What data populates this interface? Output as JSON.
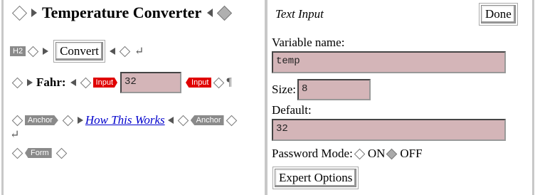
{
  "editor": {
    "heading": "Temperature Converter",
    "h2_tag": "H2",
    "convert_button": "Convert",
    "fahr_label": "Fahr:",
    "input_tag_open": "Input",
    "input_tag_close": "Input",
    "fahr_value": "32",
    "pilcrow": "¶",
    "anchor_tag_open": "Anchor",
    "link_text": "How This Works",
    "anchor_tag_close": "Anchor",
    "form_tag": "Form"
  },
  "panel": {
    "title": "Text Input",
    "done_button": "Done",
    "variable_label": "Variable name:",
    "variable_value": "temp",
    "size_label": "Size:",
    "size_value": "8",
    "default_label": "Default:",
    "default_value": "32",
    "password_label": "Password Mode:",
    "on_label": "ON",
    "off_label": "OFF",
    "password_selected": "OFF",
    "expert_button": "Expert Options"
  },
  "colors": {
    "field_bg": "#d4b5b8",
    "tag_red": "#e00000",
    "tag_grey": "#8a8a8a",
    "frame": "#c8c8c8",
    "link": "#0000cc"
  }
}
